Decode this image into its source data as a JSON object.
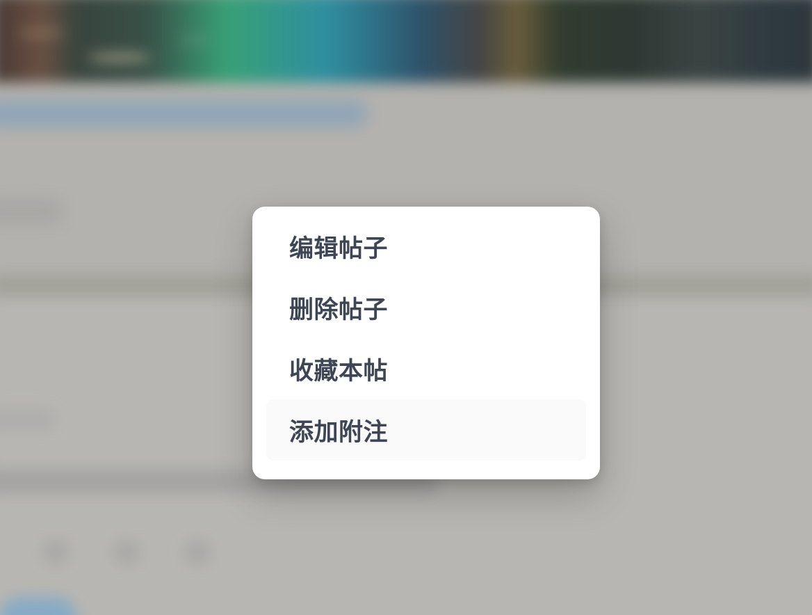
{
  "overlay": {
    "background_color": "#b8b6b2"
  },
  "context_menu": {
    "items": [
      {
        "label": "编辑帖子",
        "icon": "edit-icon"
      },
      {
        "label": "删除帖子",
        "icon": "delete-icon"
      },
      {
        "label": "收藏本帖",
        "icon": "favorite-icon"
      },
      {
        "label": "添加附注",
        "icon": "add-note-icon",
        "highlighted": true
      }
    ],
    "text_color": "#3e4656",
    "background_color": "#ffffff"
  }
}
